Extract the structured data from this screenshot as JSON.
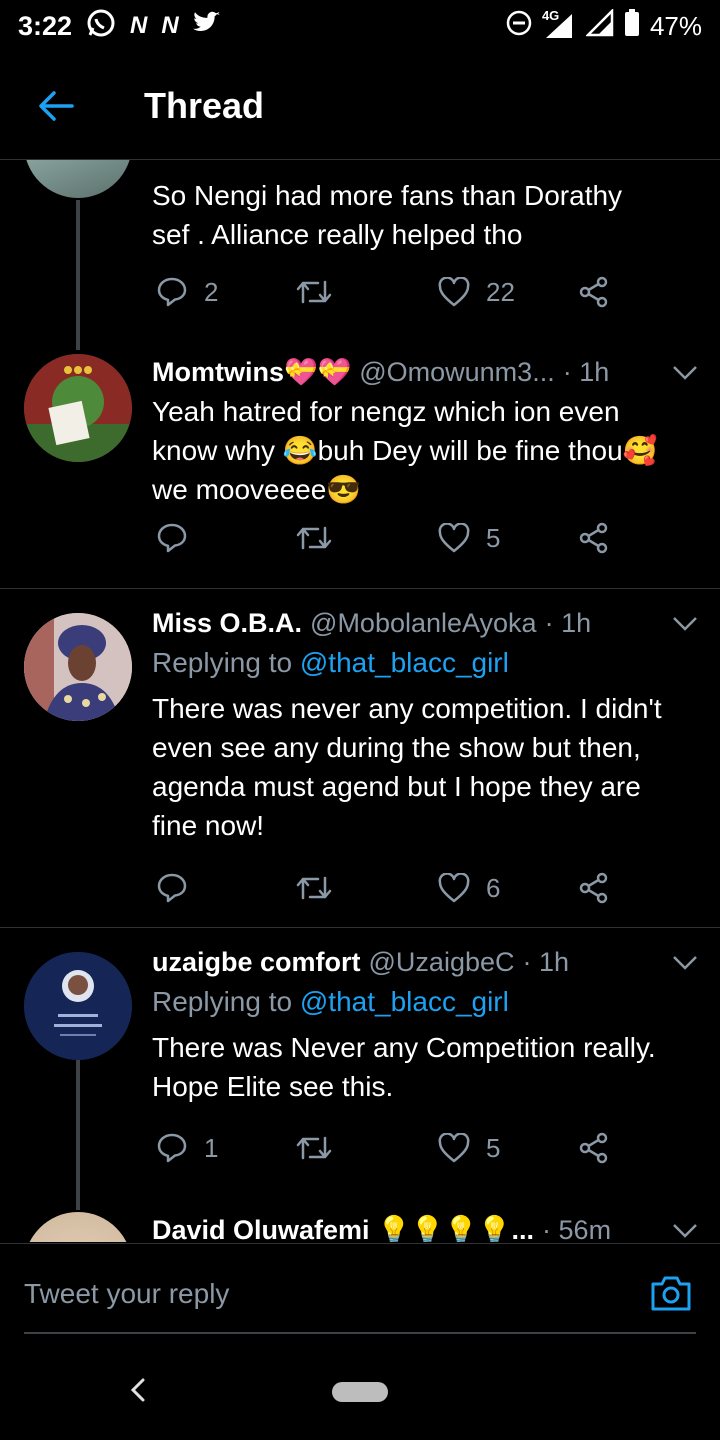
{
  "status_bar": {
    "time": "3:22",
    "apps": [
      "N",
      "N"
    ],
    "network": "4G",
    "battery": "47%"
  },
  "header": {
    "title": "Thread"
  },
  "tweets": [
    {
      "text_lines": [
        "So Nengi had more fans than Dorathy",
        "sef . Alliance really helped tho"
      ],
      "replies": "2",
      "retweets": "",
      "likes": "22"
    },
    {
      "name": "Momtwins💝💝",
      "handle": "@Omowunm3...",
      "time": "· 1h",
      "text_lines": [
        "Yeah hatred for nengz which ion even",
        "know why 😂buh Dey will be fine thou🥰",
        "we mooveeee😎"
      ],
      "replies": "",
      "retweets": "",
      "likes": "5"
    },
    {
      "name": "Miss O.B.A.",
      "handle": "@MobolanleAyoka",
      "time": "· 1h",
      "replying_prefix": "Replying to ",
      "replying_to": "@that_blacc_girl",
      "text_lines": [
        "There was never any competition. I didn't",
        "even see any during the show but then,",
        "agenda must agend but I hope they are",
        "fine now!"
      ],
      "replies": "",
      "retweets": "",
      "likes": "6"
    },
    {
      "name": "uzaigbe comfort",
      "handle": "@UzaigbeC",
      "time": "· 1h",
      "replying_prefix": "Replying to ",
      "replying_to": "@that_blacc_girl",
      "text_lines": [
        "There was Never any Competition really.",
        "Hope Elite see this."
      ],
      "replies": "1",
      "retweets": "",
      "likes": "5"
    },
    {
      "name": "David Oluwafemi 💡💡💡💡...",
      "time": "· 56m"
    }
  ],
  "composer": {
    "placeholder": "Tweet your reply"
  },
  "colors": {
    "accent": "#1da1f2",
    "muted": "#8b98a5",
    "background": "#000000"
  }
}
